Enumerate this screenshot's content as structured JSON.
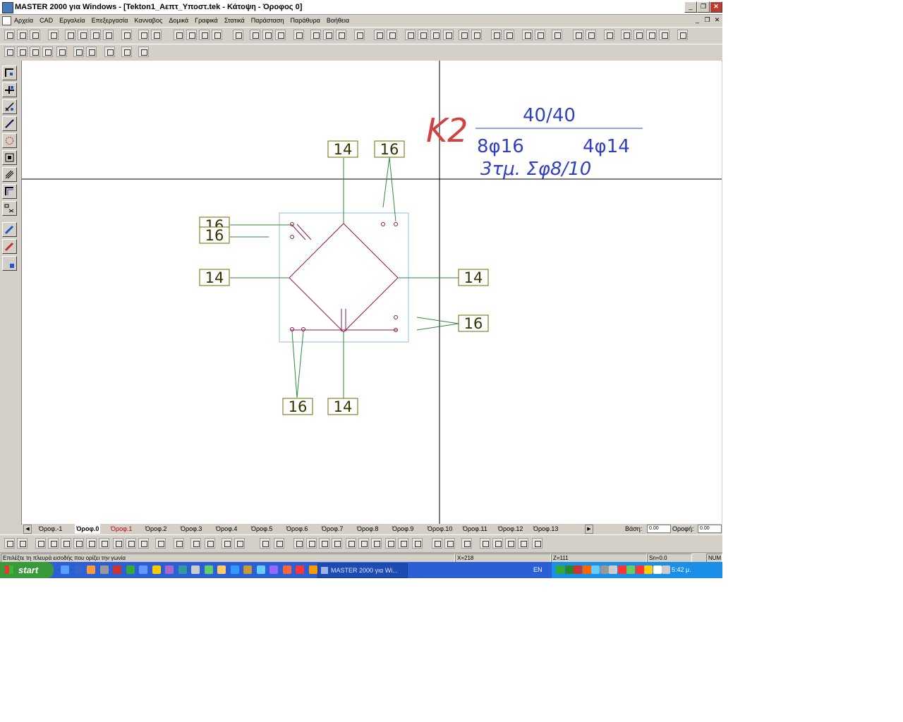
{
  "window": {
    "title": "MASTER 2000 για Windows - [Tekton1_Αεπτ_Υποστ.tek - Κάτοψη - Όροφος 0]"
  },
  "menus": [
    "Αρχεία",
    "CAD",
    "Εργαλεία",
    "Επεξεργασία",
    "Κανναβος",
    "Δομικά",
    "Γραφικά",
    "Στατικά",
    "Παράσταση",
    "Παράθυρα",
    "Βοήθεια"
  ],
  "drawing": {
    "column_name": "K2",
    "section_dims": "40/40",
    "main_rebars": "8φ16",
    "corner_rebars": "4φ14",
    "stirrups": "3τμ. Σφ8/10",
    "bar_labels": {
      "top_left": "14",
      "top_right": "16",
      "left_upper_a": "16",
      "left_upper_b": "16",
      "left_mid": "14",
      "right_mid": "14",
      "right_lower": "16",
      "bottom_left": "16",
      "bottom_mid": "14"
    }
  },
  "floor_tabs": [
    "Όροφ.-1",
    "Όροφ.0",
    "Όροφ.1",
    "Όροφ.2",
    "Όροφ.3",
    "Όροφ.4",
    "Όροφ.5",
    "Όροφ.6",
    "Όροφ.7",
    "Όροφ.8",
    "Όροφ.9",
    "Όροφ.10",
    "Όροφ.11",
    "Όροφ.12",
    "Όροφ.13"
  ],
  "active_tab": "Όροφ.0",
  "level_fields": {
    "base_label": "Βάση:",
    "base_value": "0.00",
    "roof_label": "Οροφή:",
    "roof_value": "0.00"
  },
  "status": {
    "prompt": "Επιλέξτε τη πλευρά εισοδής που ορίζει την γωνία",
    "x": "X=218",
    "z": "Z=111",
    "snap": "Sn=0.0",
    "num": "NUM"
  },
  "taskbar": {
    "start": "start",
    "task_item": "MASTER 2000 για Wi...",
    "lang": "EN",
    "clock": "5:42 μ."
  },
  "colors": {
    "grid_line": "#000000",
    "column_outline": "#8fbfdf",
    "rebar": "#8b1a4a",
    "leader": "#2e8b3a",
    "label_box": "#6b6b00",
    "column_name": "#d24040",
    "annotation": "#3040c0"
  }
}
